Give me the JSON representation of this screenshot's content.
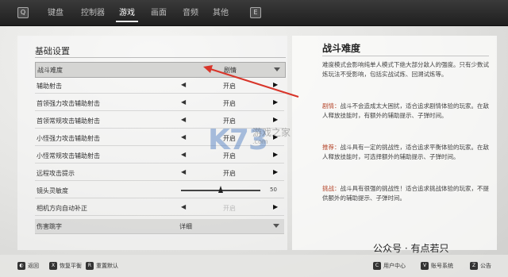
{
  "topbar": {
    "left_key": "Q",
    "right_key": "E",
    "tabs": [
      "键盘",
      "控制器",
      "游戏",
      "画面",
      "音频",
      "其他"
    ],
    "active_tab": "游戏"
  },
  "settings": {
    "section_title": "基础设置",
    "rows": [
      {
        "label": "战斗难度",
        "value": "剧情",
        "kind": "dropdown"
      },
      {
        "label": "辅助射击",
        "value": "开启",
        "kind": "toggle"
      },
      {
        "label": "首领强力攻击辅助射击",
        "value": "开启",
        "kind": "toggle"
      },
      {
        "label": "首领常规攻击辅助射击",
        "value": "开启",
        "kind": "toggle"
      },
      {
        "label": "小怪强力攻击辅助射击",
        "value": "开启",
        "kind": "toggle"
      },
      {
        "label": "小怪常规攻击辅助射击",
        "value": "开启",
        "kind": "toggle"
      },
      {
        "label": "远程攻击提示",
        "value": "开启",
        "kind": "toggle"
      },
      {
        "label": "镜头灵敏度",
        "value": "50",
        "kind": "slider",
        "level": 0.5
      },
      {
        "label": "相机方向自动补正",
        "value": "开启",
        "kind": "toggle-dim"
      },
      {
        "label": "伤害跳字",
        "value": "详细",
        "kind": "dropdown"
      }
    ]
  },
  "description": {
    "title": "战斗难度",
    "intro": "难度模式会影响纯单人模式下绝大部分敌人的强度。只有少数试炼玩法不受影响，包括实战试炼、回溯试炼等。",
    "paragraphs": [
      {
        "term": "剧情：",
        "text": "战斗不会造成太大困扰，适合追求剧情体验的玩家。在敌人释放技能时，有额外的辅助提示、子弹时间。"
      },
      {
        "term": "推荐：",
        "text": "战斗具有一定的挑战性，适合追求平衡体验的玩家。在敌人释放技能时，可选择额外的辅助提示、子弹时间。"
      },
      {
        "term": "挑战：",
        "text": "战斗具有很强的挑战性！适合追求挑战体验的玩家，不提供额外的辅助提示、子弹时间。"
      }
    ]
  },
  "bottombar": {
    "hints": [
      {
        "key": "◐",
        "label": "返回"
      },
      {
        "key": "X",
        "label": "恢复平衡"
      },
      {
        "key": "R",
        "label": "重置默认"
      }
    ],
    "right_hints": [
      {
        "key": "C",
        "label": "用户中心"
      },
      {
        "key": "V",
        "label": "账号系统"
      },
      {
        "key": "Z",
        "label": "公告"
      }
    ]
  },
  "watermark": {
    "logo": "K73",
    "sub": "游戏之家",
    "url": ".com",
    "account": "公众号 · 有点若只"
  },
  "colors": {
    "topbar": "#262626",
    "accent_term": "#b5462b",
    "annotation_arrow": "#d8352a"
  }
}
